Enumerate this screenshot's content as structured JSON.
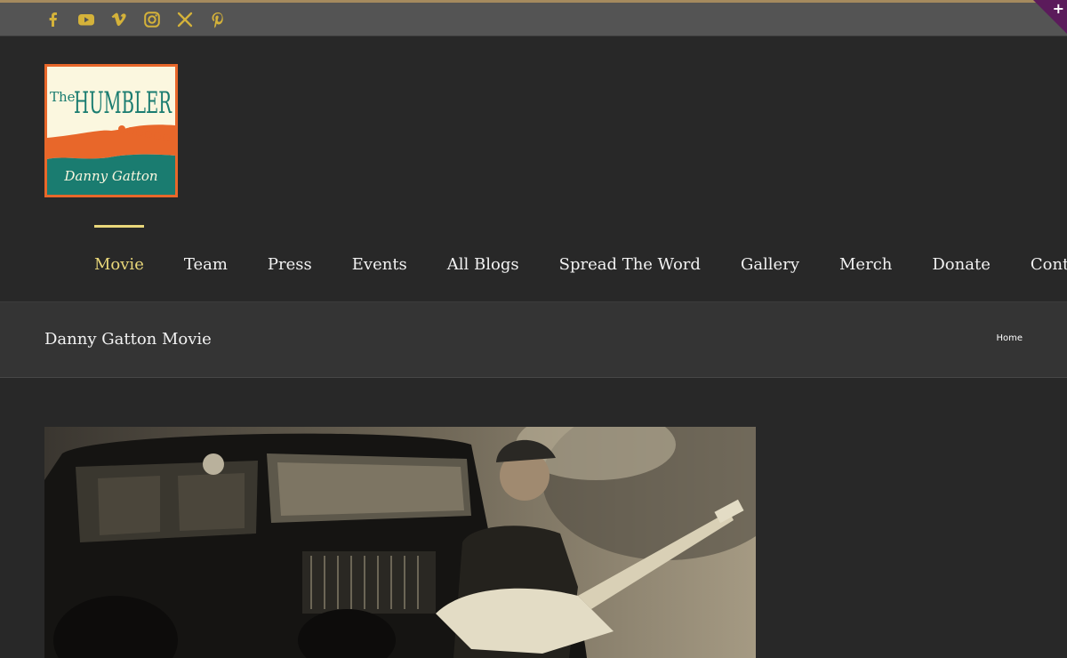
{
  "social_icons": [
    "facebook-icon",
    "youtube-icon",
    "vimeo-icon",
    "instagram-icon",
    "x-icon",
    "pinterest-icon"
  ],
  "colors": {
    "accent": "#e9d77a",
    "icon": "#d4b23a",
    "background": "#282828",
    "topbar": "#545454",
    "titlebar": "#343434",
    "corner": "#5b1b5b",
    "logo_border": "#e8672a",
    "logo_teal": "#1a7c70"
  },
  "logo": {
    "title_small": "The",
    "title_large": "HUMBLER",
    "subtitle": "Danny Gatton"
  },
  "nav": {
    "items": [
      "Movie",
      "Team",
      "Press",
      "Events",
      "All Blogs",
      "Spread The Word",
      "Gallery",
      "Merch",
      "Donate",
      "Contact"
    ],
    "active": "Movie"
  },
  "page": {
    "title": "Danny Gatton Movie",
    "breadcrumb": "Home"
  },
  "corner_toggle": "+"
}
